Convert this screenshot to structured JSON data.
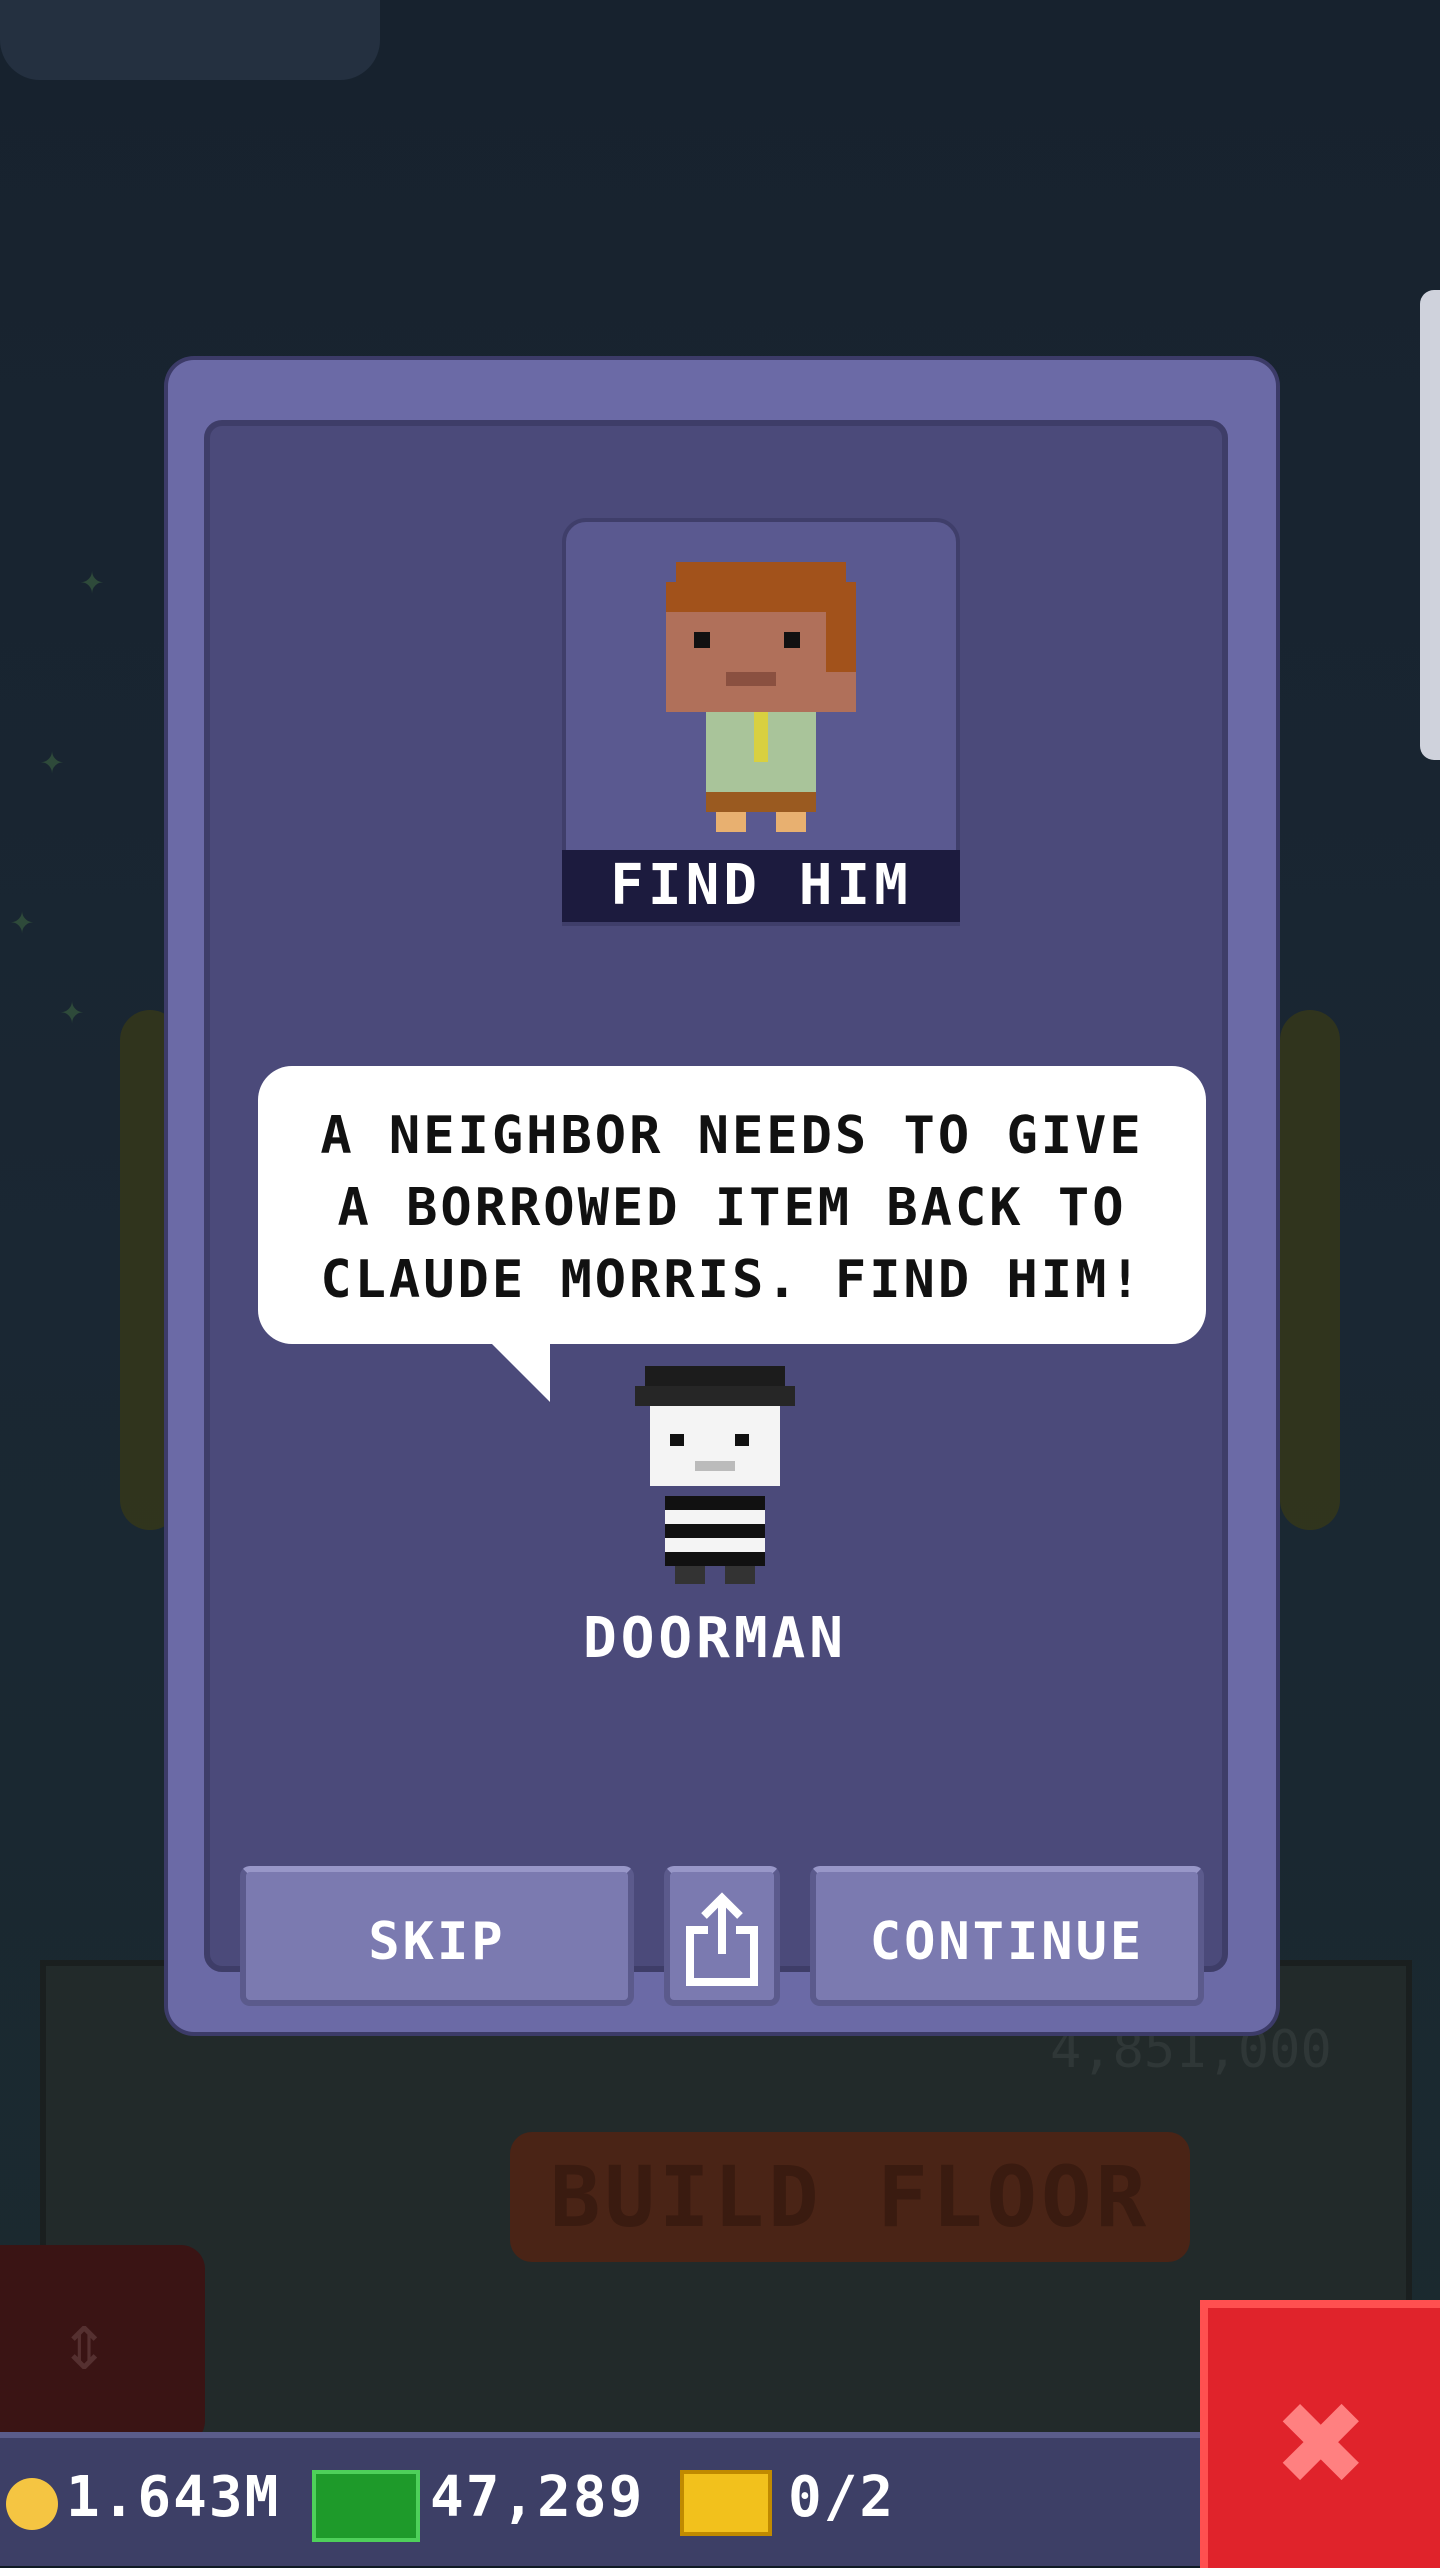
{
  "dialog": {
    "title_label": "FIND HIM",
    "message": "A NEIGHBOR NEEDS TO GIVE A BORROWED ITEM BACK TO CLAUDE MORRIS. FIND HIM!",
    "speaker_name": "DOORMAN",
    "skip_label": "SKIP",
    "continue_label": "CONTINUE",
    "share_icon": "share-icon"
  },
  "background": {
    "build_floor_label": "BUILD FLOOR",
    "build_price": "4,851,000"
  },
  "status_bar": {
    "coins": "1.643M",
    "bux": "47,289",
    "tickets": "0/2"
  },
  "colors": {
    "dialog_bg": "#6b6aa6",
    "bubble_bg": "#ffffff",
    "close_button": "#e0232b",
    "coin": "#f5c542",
    "cash": "#1e9a2a",
    "ticket": "#f2c11c"
  }
}
